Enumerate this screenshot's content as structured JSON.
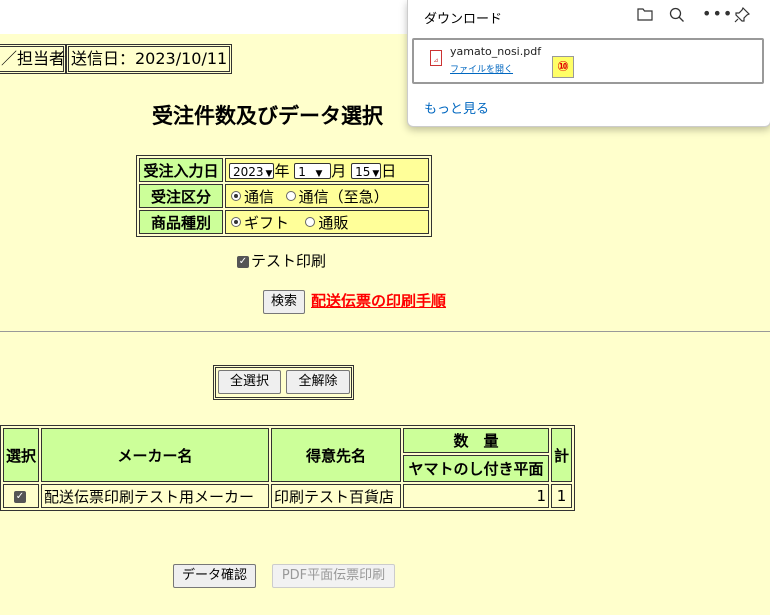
{
  "header": {
    "person_label": "／担当者",
    "send_date": "送信日：2023/10/11"
  },
  "page_title": "受注件数及びデータ選択",
  "form": {
    "order_date_label": "受注入力日",
    "year_value": "2023",
    "year_unit": "年",
    "month_value": "1",
    "month_unit": "月",
    "day_value": "15",
    "day_unit": "日",
    "order_type_label": "受注区分",
    "order_type_opt1": "通信",
    "order_type_opt2": "通信（至急）",
    "product_type_label": "商品種別",
    "product_type_opt1": "ギフト",
    "product_type_opt2": "通販",
    "test_print_label": "テスト印刷",
    "search_button": "検索",
    "manual_link": "配送伝票の印刷手順"
  },
  "selection": {
    "select_all": "全選択",
    "clear_all": "全解除"
  },
  "table": {
    "h_select": "選択",
    "h_maker": "メーカー名",
    "h_customer": "得意先名",
    "h_quantity": "数　量",
    "h_yamato": "ヤマトのし付き平面",
    "h_total": "計",
    "rows": [
      {
        "maker": "配送伝票印刷テスト用メーカー",
        "customer": "印刷テスト百貨店",
        "yamato": "1",
        "total": "1"
      }
    ]
  },
  "actions": {
    "data_confirm": "データ確認",
    "pdf_print": "PDF平面伝票印刷"
  },
  "downloads": {
    "title": "ダウンロード",
    "file_name": "yamato_nosi.pdf",
    "open_file": "ファイルを開く",
    "badge": "⑩",
    "more": "もっと見る"
  }
}
